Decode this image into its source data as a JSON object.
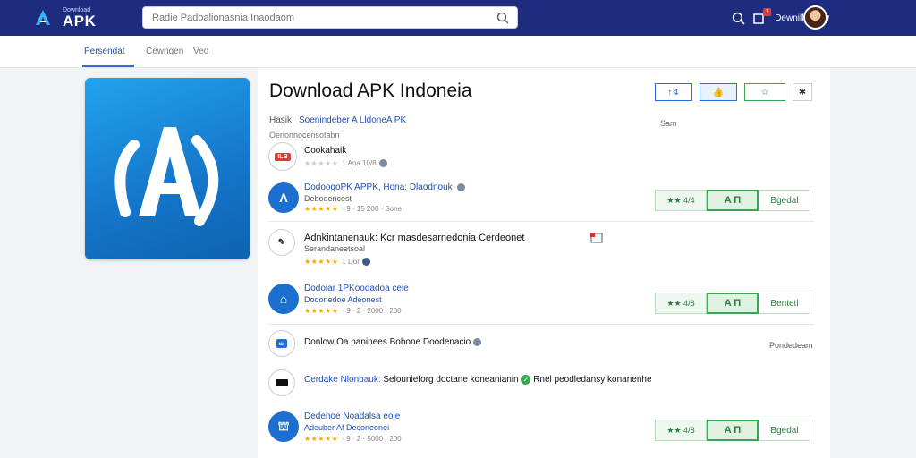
{
  "header": {
    "logo_sub": "Download",
    "logo_main": "APK",
    "search_placeholder": "Radie Padoalionasnia Inaodaom",
    "notif_count": "1",
    "user_label": "Dewnille"
  },
  "tabs": [
    {
      "label": "Persendat"
    },
    {
      "label": "Cewngen"
    },
    {
      "label": "Veo"
    }
  ],
  "app": {
    "title": "Download APK Indoneia",
    "meta_label": "Hasik",
    "meta_link": "Soenindeber A LldoneA PK",
    "meta_sub": "Oenonnocensotabn",
    "side_label": "Sam",
    "top_actions": [
      "↑↯",
      "👍",
      "☆",
      "✱"
    ]
  },
  "rows": [
    {
      "icon": "ILB",
      "icon_style": "white",
      "name": "Cookahaik",
      "stars": "★★★★★",
      "stars_grey": true,
      "meta": "1 Ana 10/8"
    },
    {
      "icon": "Λ",
      "icon_style": "blue",
      "name": "DodoogoPK APPK, Hona: Dlaodnouk",
      "sub": "Debodencest",
      "stars": "★★★★★",
      "meta": "· 9 · 15 200 · Sone",
      "btn_a": "★★ 4/4",
      "btn_b": "A Π",
      "btn_c": "Bgedal"
    },
    {
      "icon": "✎",
      "icon_style": "white",
      "name": "Adnkintanenauk: Kcr masdesarnedonia Cerdeonet",
      "sub": "Serandaneetsoal",
      "stars": "★★★★★",
      "meta": "1 Dor"
    },
    {
      "icon": "⌂",
      "icon_style": "blue",
      "name": "Dodoiar 1PKoodadoa  cele",
      "sub": "Dodoriedoe  Adeonest",
      "stars": "★★★★★",
      "meta": "· 9 · 2 · 2000 · 200",
      "btn_a": "★★ 4/8",
      "btn_b": "A Π",
      "btn_c": "Bentetl"
    },
    {
      "icon": "▭",
      "icon_style": "white",
      "name": "Donlow Oa naninees Bohone Doodenacio",
      "right": "Pondedeam"
    },
    {
      "icon": "▬",
      "icon_style": "dark",
      "name": "Cerdake Nlonbauk:",
      "name2": "Selounieforg doctane koneanianin",
      "name3": "Rnel peodledansy konanenhe"
    },
    {
      "icon": "⛫",
      "icon_style": "blue",
      "name": "Dedenoe Noadalsa  eole",
      "sub": "Adeuber Af Deconeonei",
      "stars": "★★★★★",
      "meta": "· 9 · 2 · 5000 · 200",
      "btn_a": "★★ 4/8",
      "btn_b": "A Π",
      "btn_c": "Bgedal"
    }
  ]
}
